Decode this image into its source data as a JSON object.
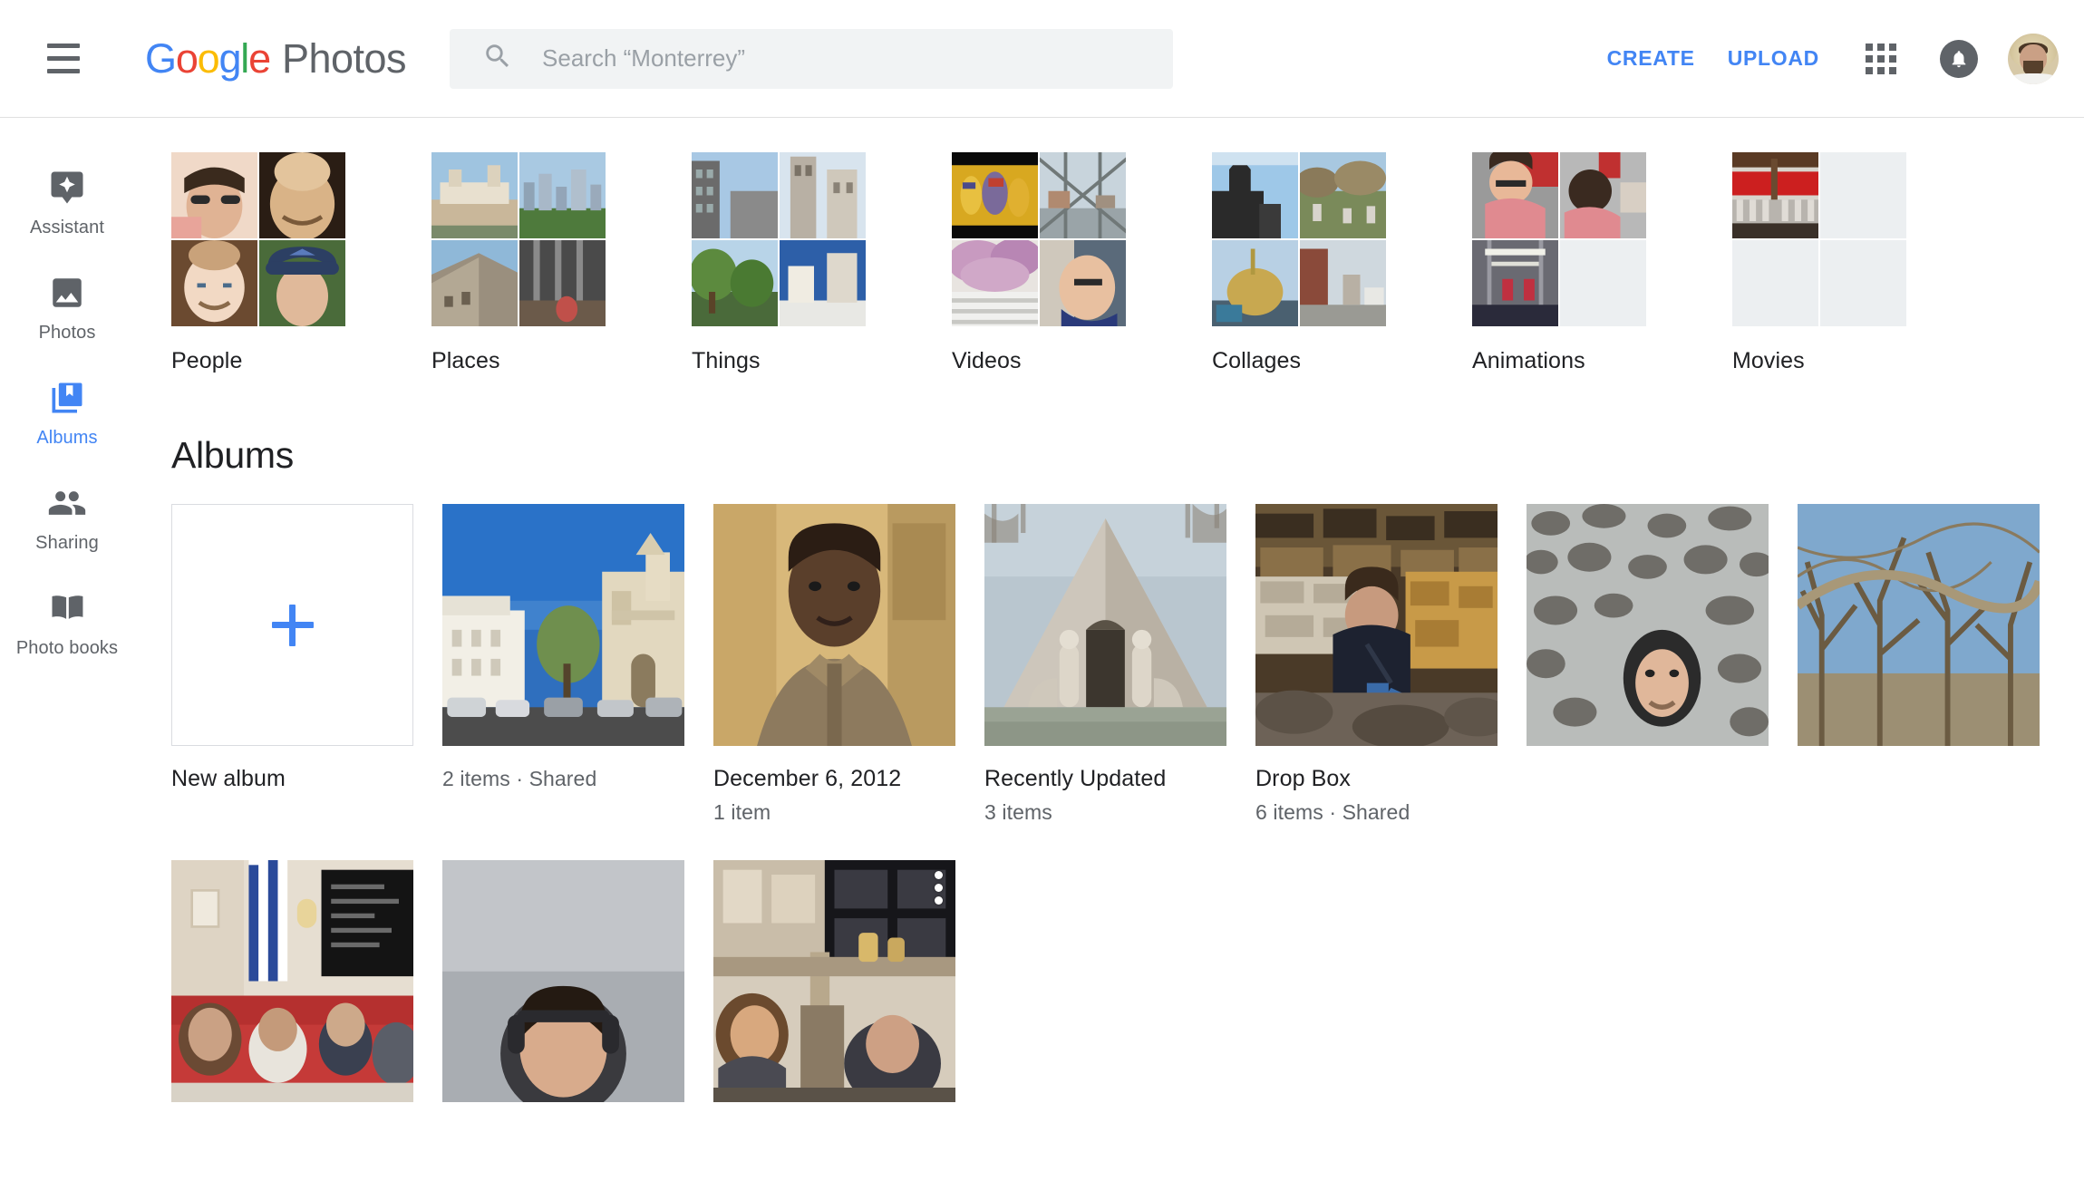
{
  "app": {
    "brand_google_letters": [
      "G",
      "o",
      "o",
      "g",
      "l",
      "e"
    ],
    "brand_product": "Photos",
    "accent_blue": "#4285F4",
    "text_primary": "#202124",
    "text_secondary": "#5f6368",
    "empty_tile_color": "#eceff1"
  },
  "header": {
    "menu_icon": "hamburger-menu-icon",
    "search": {
      "icon": "search-icon",
      "placeholder": "Search “Monterrey”",
      "value": ""
    },
    "create_label": "CREATE",
    "upload_label": "UPLOAD",
    "apps_icon": "apps-grid-icon",
    "notifications_icon": "bell-icon",
    "avatar_icon": "user-avatar"
  },
  "sidebar": {
    "items": [
      {
        "label": "Assistant",
        "icon": "assistant-sparkle-icon",
        "active": false
      },
      {
        "label": "Photos",
        "icon": "photo-mountain-icon",
        "active": false
      },
      {
        "label": "Albums",
        "icon": "albums-bookmark-icon",
        "active": true
      },
      {
        "label": "Sharing",
        "icon": "people-sharing-icon",
        "active": false
      },
      {
        "label": "Photo books",
        "icon": "photo-book-icon",
        "active": false
      }
    ]
  },
  "categories": [
    {
      "label": "People",
      "filled_tiles": 4,
      "total_tiles": 4
    },
    {
      "label": "Places",
      "filled_tiles": 4,
      "total_tiles": 4
    },
    {
      "label": "Things",
      "filled_tiles": 4,
      "total_tiles": 4
    },
    {
      "label": "Videos",
      "filled_tiles": 4,
      "total_tiles": 4
    },
    {
      "label": "Collages",
      "filled_tiles": 4,
      "total_tiles": 4
    },
    {
      "label": "Animations",
      "filled_tiles": 3,
      "total_tiles": 4
    },
    {
      "label": "Movies",
      "filled_tiles": 1,
      "total_tiles": 4
    }
  ],
  "albums_section": {
    "heading": "Albums",
    "new_album": {
      "label": "New album",
      "icon": "plus-icon"
    },
    "albums": [
      {
        "title": "",
        "meta": "2 items  ·  Shared",
        "has_overflow": false
      },
      {
        "title": "December 6, 2012",
        "meta": "1 item",
        "has_overflow": false
      },
      {
        "title": "Recently Updated",
        "meta": "3 items",
        "has_overflow": false
      },
      {
        "title": "Drop Box",
        "meta": "6 items  ·  Shared",
        "has_overflow": false
      }
    ],
    "albums_row2": [
      {
        "title": "",
        "meta": "",
        "has_overflow": false
      },
      {
        "title": "",
        "meta": "",
        "has_overflow": false
      },
      {
        "title": "",
        "meta": "",
        "has_overflow": false
      },
      {
        "title": "",
        "meta": "",
        "has_overflow": false
      },
      {
        "title": "",
        "meta": "",
        "has_overflow": true
      }
    ]
  }
}
